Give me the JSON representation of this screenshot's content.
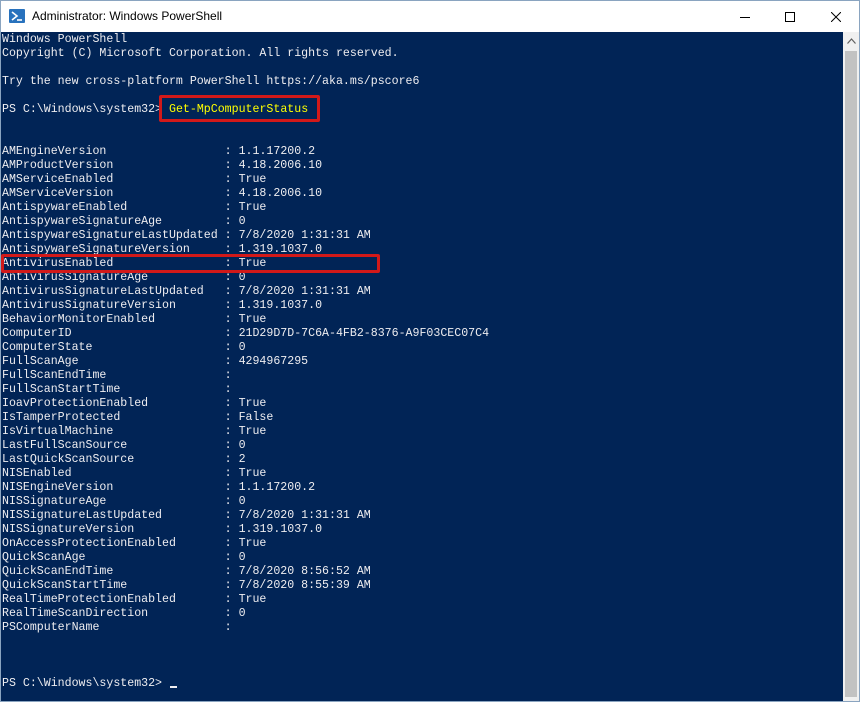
{
  "window": {
    "title": "Administrator: Windows PowerShell"
  },
  "header_lines": [
    "Windows PowerShell",
    "Copyright (C) Microsoft Corporation. All rights reserved.",
    "",
    "Try the new cross-platform PowerShell https://aka.ms/pscore6"
  ],
  "prompt": {
    "text": "PS C:\\Windows\\system32>",
    "command": "Get-MpComputerStatus"
  },
  "status_rows": [
    {
      "name": "AMEngineVersion",
      "value": "1.1.17200.2"
    },
    {
      "name": "AMProductVersion",
      "value": "4.18.2006.10"
    },
    {
      "name": "AMServiceEnabled",
      "value": "True"
    },
    {
      "name": "AMServiceVersion",
      "value": "4.18.2006.10"
    },
    {
      "name": "AntispywareEnabled",
      "value": "True"
    },
    {
      "name": "AntispywareSignatureAge",
      "value": "0"
    },
    {
      "name": "AntispywareSignatureLastUpdated",
      "value": "7/8/2020 1:31:31 AM"
    },
    {
      "name": "AntispywareSignatureVersion",
      "value": "1.319.1037.0"
    },
    {
      "name": "AntivirusEnabled",
      "value": "True"
    },
    {
      "name": "AntivirusSignatureAge",
      "value": "0"
    },
    {
      "name": "AntivirusSignatureLastUpdated",
      "value": "7/8/2020 1:31:31 AM"
    },
    {
      "name": "AntivirusSignatureVersion",
      "value": "1.319.1037.0"
    },
    {
      "name": "BehaviorMonitorEnabled",
      "value": "True"
    },
    {
      "name": "ComputerID",
      "value": "21D29D7D-7C6A-4FB2-8376-A9F03CEC07C4"
    },
    {
      "name": "ComputerState",
      "value": "0"
    },
    {
      "name": "FullScanAge",
      "value": "4294967295"
    },
    {
      "name": "FullScanEndTime",
      "value": ""
    },
    {
      "name": "FullScanStartTime",
      "value": ""
    },
    {
      "name": "IoavProtectionEnabled",
      "value": "True"
    },
    {
      "name": "IsTamperProtected",
      "value": "False"
    },
    {
      "name": "IsVirtualMachine",
      "value": "True"
    },
    {
      "name": "LastFullScanSource",
      "value": "0"
    },
    {
      "name": "LastQuickScanSource",
      "value": "2"
    },
    {
      "name": "NISEnabled",
      "value": "True"
    },
    {
      "name": "NISEngineVersion",
      "value": "1.1.17200.2"
    },
    {
      "name": "NISSignatureAge",
      "value": "0"
    },
    {
      "name": "NISSignatureLastUpdated",
      "value": "7/8/2020 1:31:31 AM"
    },
    {
      "name": "NISSignatureVersion",
      "value": "1.319.1037.0"
    },
    {
      "name": "OnAccessProtectionEnabled",
      "value": "True"
    },
    {
      "name": "QuickScanAge",
      "value": "0"
    },
    {
      "name": "QuickScanEndTime",
      "value": "7/8/2020 8:56:52 AM"
    },
    {
      "name": "QuickScanStartTime",
      "value": "7/8/2020 8:55:39 AM"
    },
    {
      "name": "RealTimeProtectionEnabled",
      "value": "True"
    },
    {
      "name": "RealTimeScanDirection",
      "value": "0"
    },
    {
      "name": "PSComputerName",
      "value": ""
    }
  ],
  "final_prompt": "PS C:\\Windows\\system32>",
  "colors": {
    "console_background": "#012456",
    "console_text": "#eeedf0",
    "command_text": "#ffff00",
    "highlight_border": "#d21919"
  },
  "icons": {
    "app": "powershell-icon",
    "minimize": "minimize-icon",
    "maximize": "maximize-icon",
    "close": "close-icon",
    "scroll_up": "chevron-up-icon"
  }
}
